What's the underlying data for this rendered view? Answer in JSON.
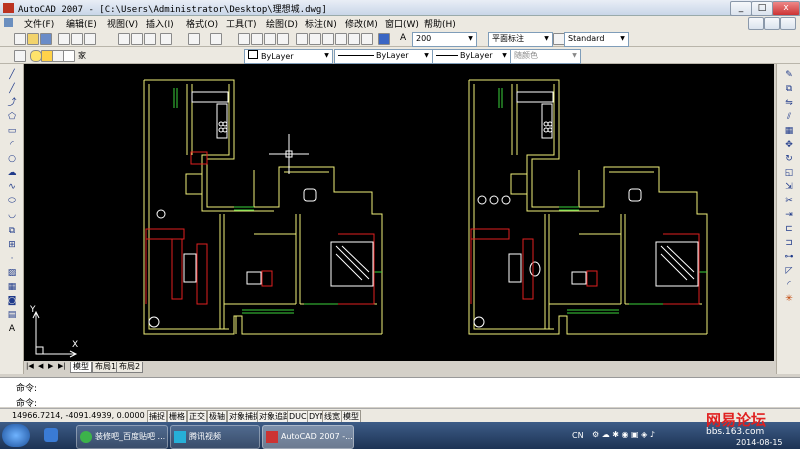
{
  "window": {
    "title": "AutoCAD 2007 - [C:\\Users\\Administrator\\Desktop\\理想城.dwg]",
    "min_glyph": "_",
    "restore_glyph": "□",
    "close_glyph": "x"
  },
  "menu": [
    "文件(F)",
    "编辑(E)",
    "视图(V)",
    "插入(I)",
    "格式(O)",
    "工具(T)",
    "绘图(D)",
    "标注(N)",
    "修改(M)",
    "窗口(W)",
    "帮助(H)"
  ],
  "styles": {
    "text_height": "200",
    "dim_style": "平面标注",
    "table_style": "Standard"
  },
  "layers": {
    "current_layer": "家",
    "color": "ByLayer",
    "linetype": "ByLayer",
    "lineweight": "ByLayer",
    "plot_style": "随颜色"
  },
  "layout_tabs": [
    "模型",
    "布局1",
    "布局2"
  ],
  "command": {
    "line1": "命令:",
    "line2": "命令:"
  },
  "status": {
    "coords": "14966.7214, -4091.4939, 0.0000",
    "buttons": [
      "捕捉",
      "栅格",
      "正交",
      "极轴",
      "对象捕捉",
      "对象追踪",
      "DUCS",
      "DYN",
      "线宽",
      "模型"
    ]
  },
  "ucs": {
    "x_label": "X",
    "y_label": "Y"
  },
  "taskbar": {
    "items": [
      "装修吧_百度贴吧 ...",
      "腾讯视频",
      "AutoCAD 2007 -..."
    ],
    "lang": "CN",
    "watermark": "网易论坛",
    "watermark_sub": "bbs.163.com",
    "date": "2014-08-15"
  },
  "colors": {
    "canvas": "#000000",
    "wall": "#f0f07a",
    "furniture": "#ffffff",
    "red": "#e02020",
    "green": "#3cd23c"
  }
}
